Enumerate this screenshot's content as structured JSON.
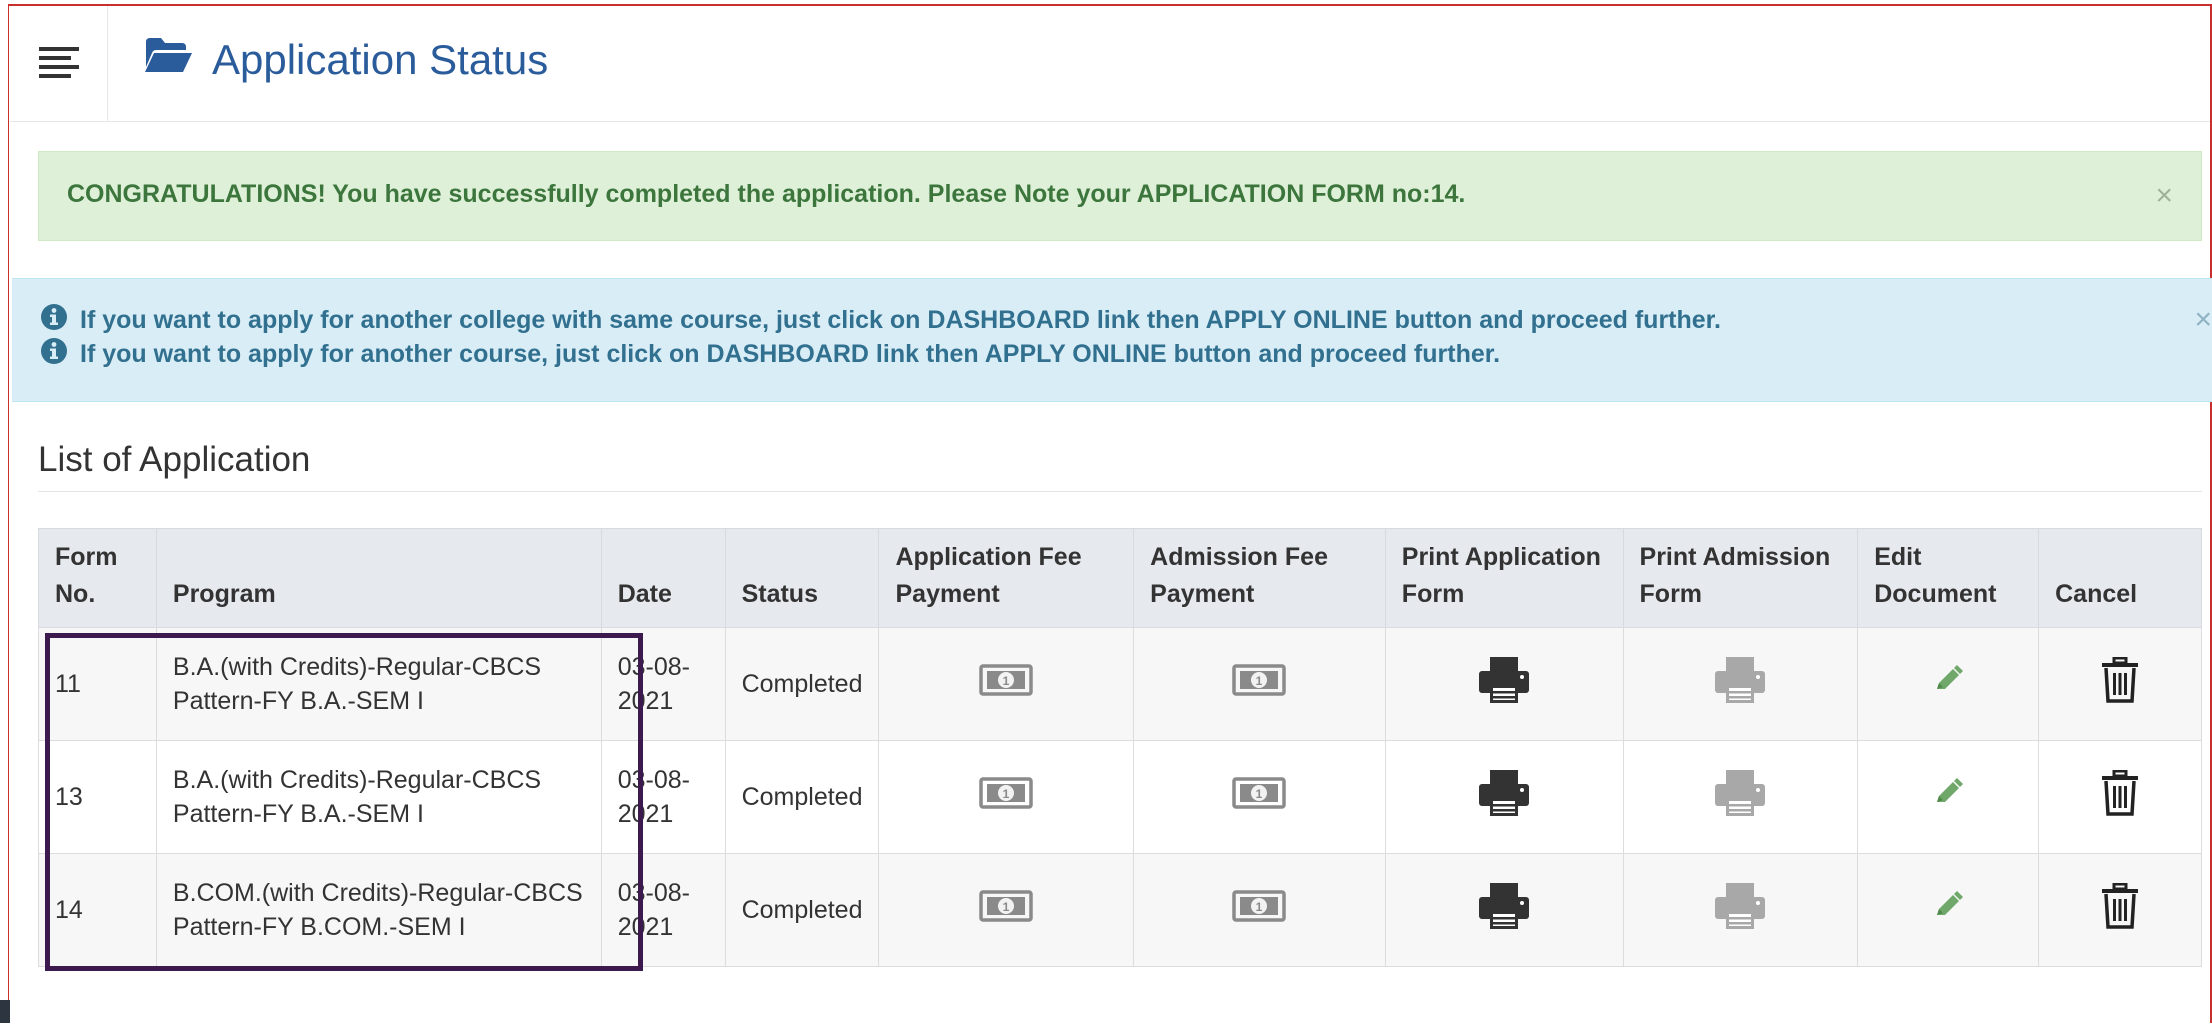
{
  "header": {
    "title": "Application Status"
  },
  "alerts": {
    "success": "CONGRATULATIONS! You have successfully completed the application. Please Note your APPLICATION FORM no:14.",
    "info": [
      "If you want to apply for another college with same course, just click on DASHBOARD link then APPLY ONLINE button and proceed further.",
      "If you want to apply for another course, just click on DASHBOARD link then APPLY ONLINE button and proceed further."
    ],
    "close_glyph": "×"
  },
  "list": {
    "title": "List of Application",
    "columns": [
      [
        "Form",
        "No."
      ],
      [
        "Program"
      ],
      [
        "Date"
      ],
      [
        "Status"
      ],
      [
        "Application Fee",
        "Payment"
      ],
      [
        "Admission Fee",
        "Payment"
      ],
      [
        "Print Application",
        "Form"
      ],
      [
        "Print Admission",
        "Form"
      ],
      [
        "Edit",
        "Document"
      ],
      [
        "Cancel"
      ]
    ],
    "rows": [
      {
        "form_no": "11",
        "program": [
          "B.A.(with Credits)-Regular-CBCS",
          "Pattern-FY B.A.-SEM I"
        ],
        "date": [
          "03-08-",
          "2021"
        ],
        "status": "Completed"
      },
      {
        "form_no": "13",
        "program": [
          "B.A.(with Credits)-Regular-CBCS",
          "Pattern-FY B.A.-SEM I"
        ],
        "date": [
          "03-08-",
          "2021"
        ],
        "status": "Completed"
      },
      {
        "form_no": "14",
        "program": [
          "B.COM.(with Credits)-Regular-CBCS",
          "Pattern-FY B.COM.-SEM I"
        ],
        "date": [
          "03-08-",
          "2021"
        ],
        "status": "Completed"
      }
    ]
  },
  "icons": {
    "menu": "menu-lines-icon",
    "title": "folder-open-icon",
    "info": "info-circle-icon",
    "app_fee": "money-icon",
    "adm_fee": "money-icon",
    "print_app": "print-icon",
    "print_adm": "print-icon",
    "edit": "pencil-icon",
    "cancel": "trash-icon"
  },
  "colors": {
    "title": "#2a5b9a",
    "success_bg": "#dff0d8",
    "success_text": "#3c763d",
    "info_bg": "#d9edf7",
    "info_text": "#31708f",
    "print_active": "#333333",
    "print_disabled": "#a8a8a8",
    "edit": "#6fa86a",
    "highlight": "#3d1a4e"
  }
}
